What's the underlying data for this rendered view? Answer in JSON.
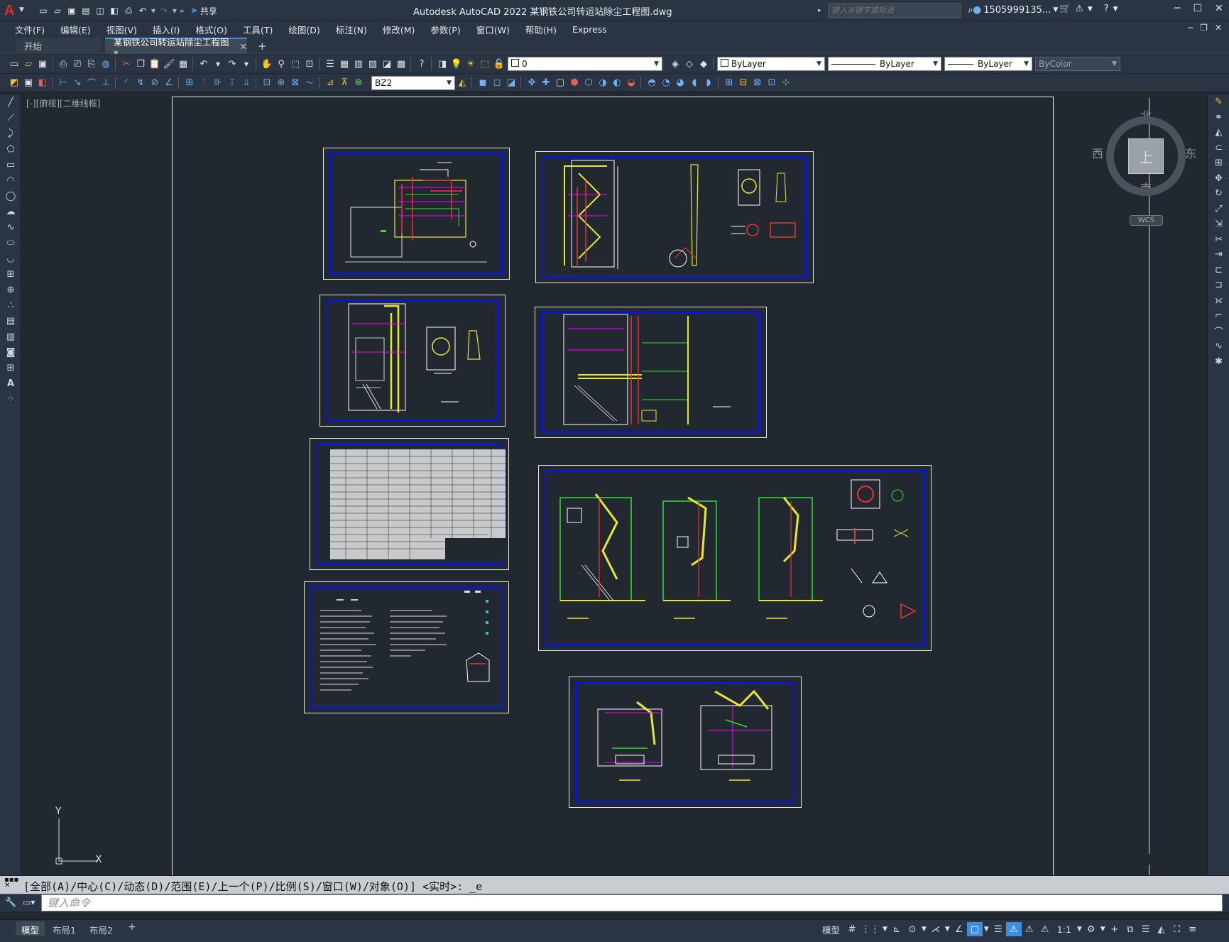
{
  "app": {
    "logo": "A",
    "title": "Autodesk AutoCAD 2022    某钢铁公司转运站除尘工程图.dwg",
    "share_label": "共享",
    "search_placeholder": "键入关键字或短语",
    "user": "1505999135..."
  },
  "menu": [
    "文件(F)",
    "编辑(E)",
    "视图(V)",
    "插入(I)",
    "格式(O)",
    "工具(T)",
    "绘图(D)",
    "标注(N)",
    "修改(M)",
    "参数(P)",
    "窗口(W)",
    "帮助(H)",
    "Express"
  ],
  "tabs": {
    "start": "开始",
    "document": "某钢铁公司转运站除尘工程图*"
  },
  "toolbar": {
    "layer": "0",
    "color": "ByLayer",
    "linetype": "ByLayer",
    "lineweight": "ByLayer",
    "plotstyle": "ByColor",
    "dimstyle": "BZ2"
  },
  "viewport_label": "[-][俯视][二维线框]",
  "viewcube": {
    "north": "北",
    "south": "南",
    "west": "西",
    "east": "东",
    "face": "上",
    "wcs": "WCS"
  },
  "ucs": {
    "x": "X",
    "y": "Y"
  },
  "command": {
    "history": "[全部(A)/中心(C)/动态(D)/范围(E)/上一个(P)/比例(S)/窗口(W)/对象(O)] <实时>: _e",
    "placeholder": "键入命令"
  },
  "layouts": {
    "model": "模型",
    "layout1": "布局1",
    "layout2": "布局2"
  },
  "status": {
    "model": "模型",
    "scale": "1:1"
  },
  "colors": {
    "accent": "#3c8fe0",
    "sheet_inner_border": "#0a18c8",
    "canvas": "#212830"
  }
}
